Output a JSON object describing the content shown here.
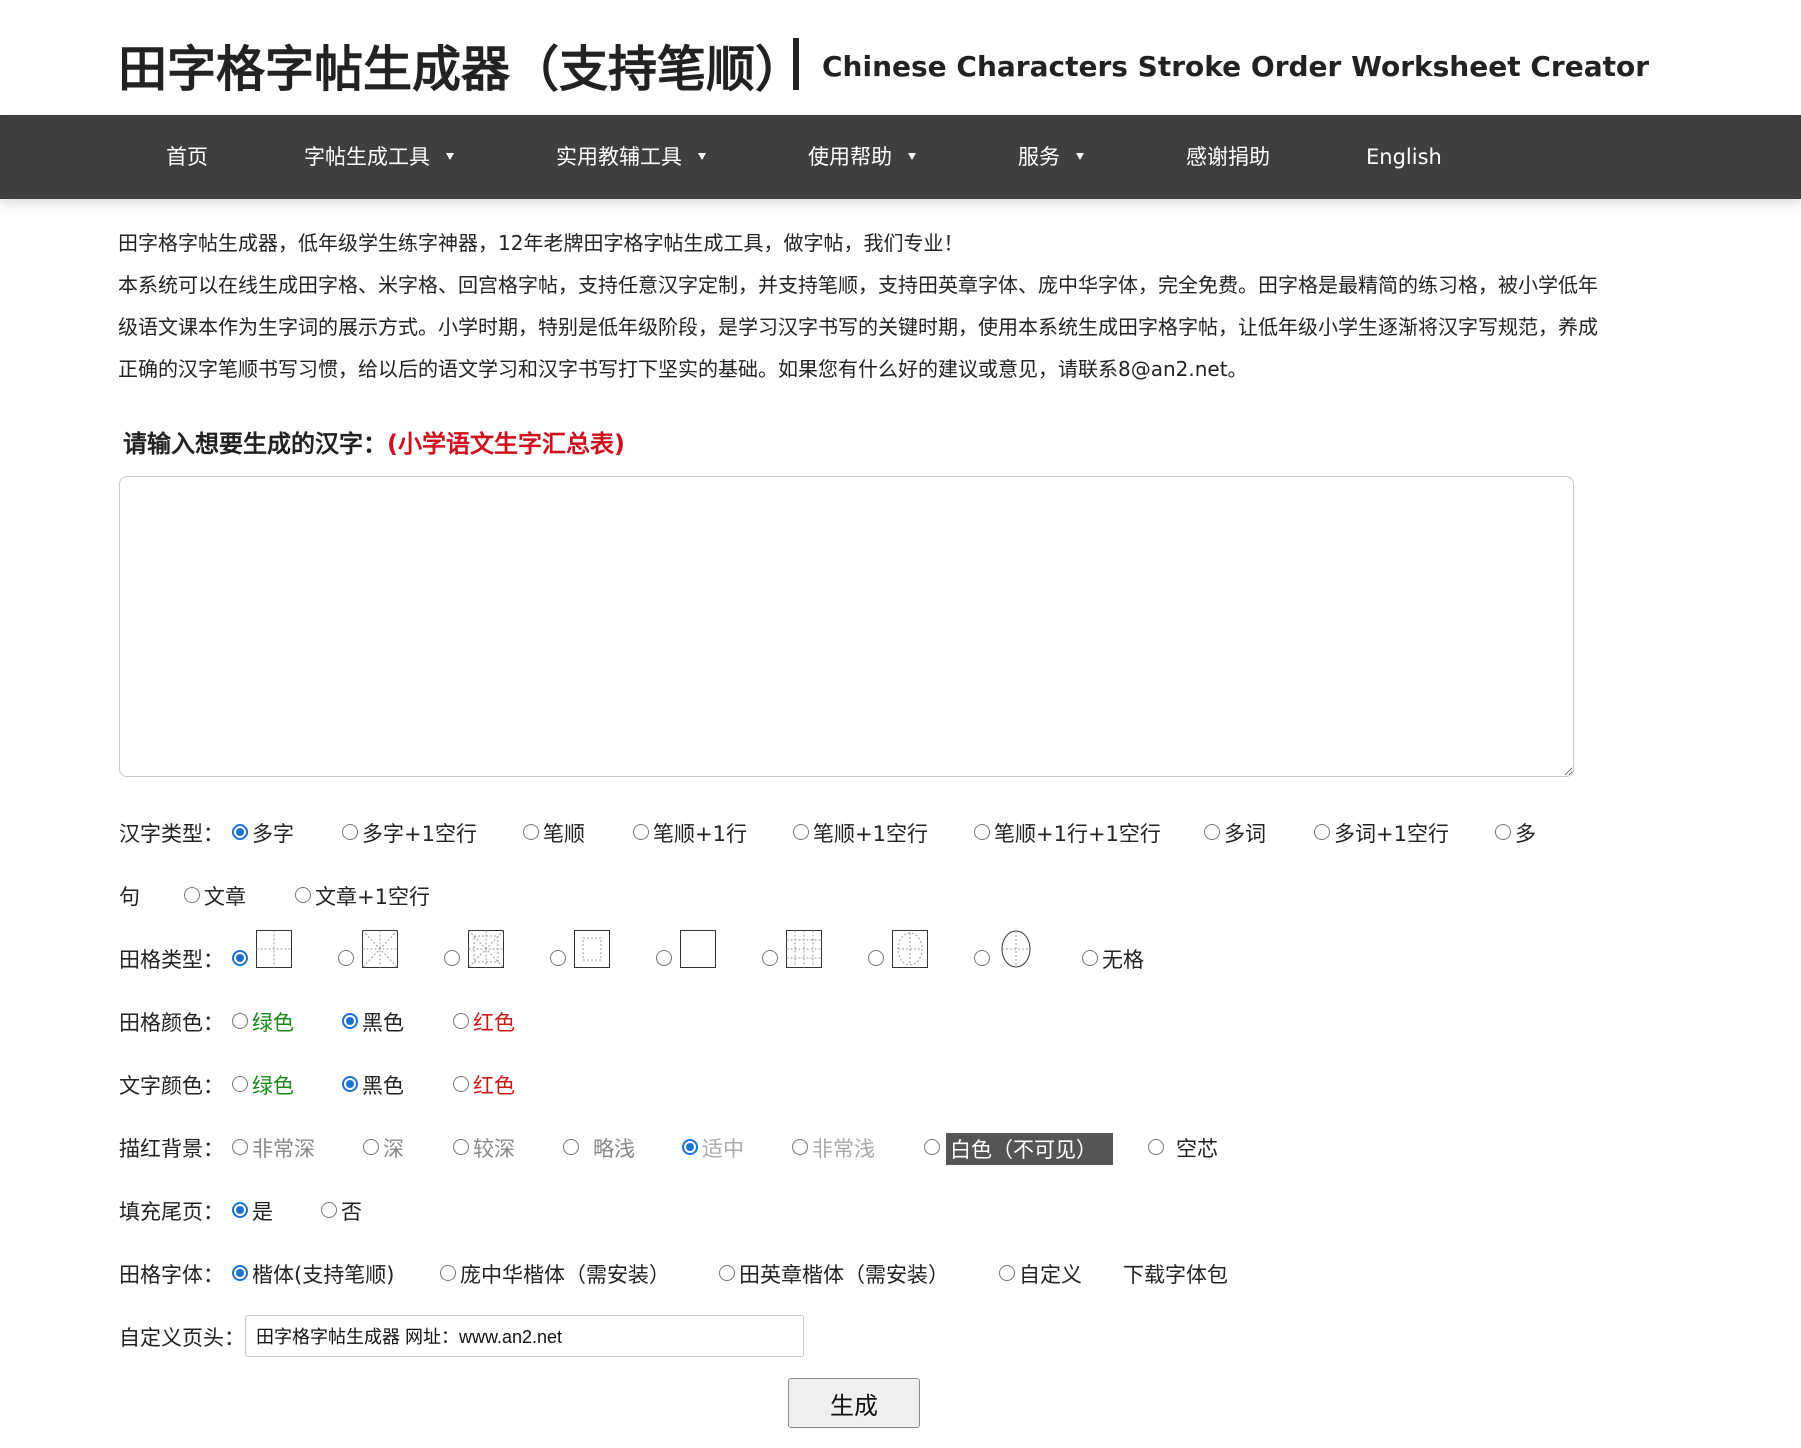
{
  "header": {
    "title_cn": "田字格字帖生成器（支持笔顺）",
    "title_en": "Chinese Characters Stroke Order Worksheet Creator"
  },
  "nav": {
    "items": [
      {
        "label": "首页"
      },
      {
        "label": "字帖生成工具"
      },
      {
        "label": "实用教辅工具"
      },
      {
        "label": "使用帮助"
      },
      {
        "label": "服务"
      },
      {
        "label": "感谢捐助"
      },
      {
        "label": "English"
      }
    ]
  },
  "intro": {
    "line1": "田字格字帖生成器，低年级学生练字神器，12年老牌田字格字帖生成工具，做字帖，我们专业！",
    "line2": "本系统可以在线生成田字格、米字格、回宫格字帖，支持任意汉字定制，并支持笔顺，支持田英章字体、庞中华字体，完全免费。田字格是最精简的练习格，被小学低年级语文课本作为生字词的展示方式。小学时期，特别是低年级阶段，是学习汉字书写的关键时期，使用本系统生成田字格字帖，让低年级小学生逐渐将汉字写规范，养成正确的汉字笔顺书写习惯，给以后的语文学习和汉字书写打下坚实的基础。如果您有什么好的建议或意见，请联系8@an2.net。"
  },
  "prompt": {
    "label": "请输入想要生成的汉字：",
    "link": "(小学语文生字汇总表)"
  },
  "textarea": {
    "value": ""
  },
  "char_type": {
    "label": "汉字类型：",
    "options": [
      "多字",
      "多字+1空行",
      "笔顺",
      "笔顺+1行",
      "笔顺+1空行",
      "笔顺+1行+1空行",
      "多词",
      "多词+1空行",
      "多",
      "句",
      "文章",
      "文章+1空行"
    ]
  },
  "grid_type": {
    "label": "田格类型：",
    "none_label": "无格"
  },
  "grid_color": {
    "label": "田格颜色：",
    "options": [
      "绿色",
      "黑色",
      "红色"
    ]
  },
  "text_color": {
    "label": "文字颜色：",
    "options": [
      "绿色",
      "黑色",
      "红色"
    ]
  },
  "trace_bg": {
    "label": "描红背景：",
    "options": [
      "非常深",
      "深",
      "较深",
      "略浅",
      "适中",
      "非常浅",
      "白色（不可见）",
      "空芯"
    ]
  },
  "fill_last": {
    "label": "填充尾页：",
    "options": [
      "是",
      "否"
    ]
  },
  "font": {
    "label": "田格字体：",
    "options": [
      "楷体(支持笔顺)",
      "庞中华楷体（需安装）",
      "田英章楷体（需安装）",
      "自定义"
    ],
    "download": "下载字体包"
  },
  "custom_header": {
    "label": "自定义页头：",
    "value": "田字格字帖生成器 网址：www.an2.net"
  },
  "generate": {
    "label": "生成"
  },
  "colors": {
    "nav_bg": "#3f3f41",
    "link_red": "#d0101c",
    "radio_blue": "#1a73d0"
  }
}
